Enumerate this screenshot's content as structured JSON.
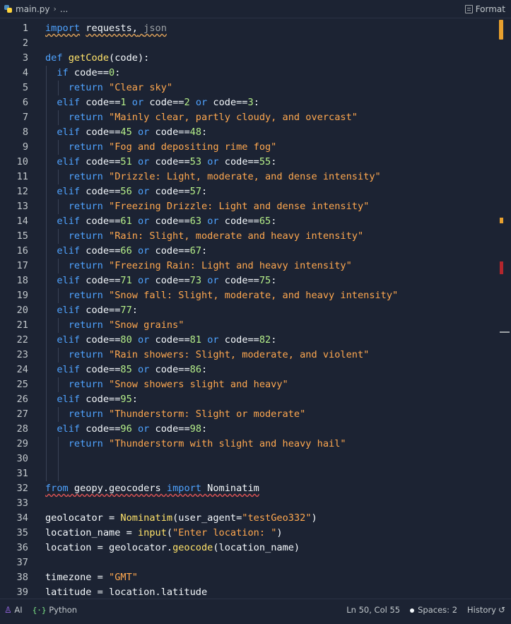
{
  "breadcrumb": {
    "file": "main.py",
    "ellipsis": "..."
  },
  "toolbar": {
    "format_label": "Format"
  },
  "icons": {
    "file": "python-file-icon",
    "format": "format-icon",
    "ai": "ai-icon",
    "language": "braces-icon",
    "history": "history-icon"
  },
  "colors": {
    "background": "#1c2333",
    "keyword": "#4fa3ff",
    "function": "#ffe36a",
    "string": "#ffa84f",
    "number": "#b6f08a",
    "scroll_thumb": "#e8a02e",
    "error_marker": "#b3262d"
  },
  "code_lines": [
    [
      {
        "t": "import",
        "c": "kw sq"
      },
      {
        "t": " ",
        "c": ""
      },
      {
        "t": "requests,",
        "c": "sq"
      },
      {
        "t": " ",
        "c": "sq"
      },
      {
        "t": "json",
        "c": "dim sq"
      }
    ],
    [],
    [
      {
        "t": "def ",
        "c": "kw"
      },
      {
        "t": "getCode",
        "c": "fn"
      },
      {
        "t": "(code):",
        "c": ""
      }
    ],
    [
      {
        "t": "  if ",
        "c": "kw"
      },
      {
        "t": "code==",
        "c": ""
      },
      {
        "t": "0",
        "c": "num"
      },
      {
        "t": ":",
        "c": ""
      }
    ],
    [
      {
        "t": "    return ",
        "c": "kw"
      },
      {
        "t": "\"Clear sky\"",
        "c": "str"
      }
    ],
    [
      {
        "t": "  elif ",
        "c": "kw"
      },
      {
        "t": "code==",
        "c": ""
      },
      {
        "t": "1",
        "c": "num"
      },
      {
        "t": " or ",
        "c": "kw"
      },
      {
        "t": "code==",
        "c": ""
      },
      {
        "t": "2",
        "c": "num"
      },
      {
        "t": " or ",
        "c": "kw"
      },
      {
        "t": "code==",
        "c": ""
      },
      {
        "t": "3",
        "c": "num"
      },
      {
        "t": ":",
        "c": ""
      }
    ],
    [
      {
        "t": "    return ",
        "c": "kw"
      },
      {
        "t": "\"Mainly clear, partly cloudy, and overcast\"",
        "c": "str"
      }
    ],
    [
      {
        "t": "  elif ",
        "c": "kw"
      },
      {
        "t": "code==",
        "c": ""
      },
      {
        "t": "45",
        "c": "num"
      },
      {
        "t": " or ",
        "c": "kw"
      },
      {
        "t": "code==",
        "c": ""
      },
      {
        "t": "48",
        "c": "num"
      },
      {
        "t": ":",
        "c": ""
      }
    ],
    [
      {
        "t": "    return ",
        "c": "kw"
      },
      {
        "t": "\"Fog and depositing rime fog\"",
        "c": "str"
      }
    ],
    [
      {
        "t": "  elif ",
        "c": "kw"
      },
      {
        "t": "code==",
        "c": ""
      },
      {
        "t": "51",
        "c": "num"
      },
      {
        "t": " or ",
        "c": "kw"
      },
      {
        "t": "code==",
        "c": ""
      },
      {
        "t": "53",
        "c": "num"
      },
      {
        "t": " or ",
        "c": "kw"
      },
      {
        "t": "code==",
        "c": ""
      },
      {
        "t": "55",
        "c": "num"
      },
      {
        "t": ":",
        "c": ""
      }
    ],
    [
      {
        "t": "    return ",
        "c": "kw"
      },
      {
        "t": "\"Drizzle: Light, moderate, and dense intensity\"",
        "c": "str"
      }
    ],
    [
      {
        "t": "  elif ",
        "c": "kw"
      },
      {
        "t": "code==",
        "c": ""
      },
      {
        "t": "56",
        "c": "num"
      },
      {
        "t": " or ",
        "c": "kw"
      },
      {
        "t": "code==",
        "c": ""
      },
      {
        "t": "57",
        "c": "num"
      },
      {
        "t": ":",
        "c": ""
      }
    ],
    [
      {
        "t": "    return ",
        "c": "kw"
      },
      {
        "t": "\"Freezing Drizzle: Light and dense intensity\"",
        "c": "str"
      }
    ],
    [
      {
        "t": "  elif ",
        "c": "kw"
      },
      {
        "t": "code==",
        "c": ""
      },
      {
        "t": "61",
        "c": "num"
      },
      {
        "t": " or ",
        "c": "kw"
      },
      {
        "t": "code==",
        "c": ""
      },
      {
        "t": "63",
        "c": "num"
      },
      {
        "t": " or ",
        "c": "kw"
      },
      {
        "t": "code==",
        "c": ""
      },
      {
        "t": "65",
        "c": "num"
      },
      {
        "t": ":",
        "c": ""
      }
    ],
    [
      {
        "t": "    return ",
        "c": "kw"
      },
      {
        "t": "\"Rain: Slight, moderate and heavy intensity\"",
        "c": "str"
      }
    ],
    [
      {
        "t": "  elif ",
        "c": "kw"
      },
      {
        "t": "code==",
        "c": ""
      },
      {
        "t": "66",
        "c": "num"
      },
      {
        "t": " or ",
        "c": "kw"
      },
      {
        "t": "code==",
        "c": ""
      },
      {
        "t": "67",
        "c": "num"
      },
      {
        "t": ":",
        "c": ""
      }
    ],
    [
      {
        "t": "    return ",
        "c": "kw"
      },
      {
        "t": "\"Freezing Rain: Light and heavy intensity\"",
        "c": "str"
      }
    ],
    [
      {
        "t": "  elif ",
        "c": "kw"
      },
      {
        "t": "code==",
        "c": ""
      },
      {
        "t": "71",
        "c": "num"
      },
      {
        "t": " or ",
        "c": "kw"
      },
      {
        "t": "code==",
        "c": ""
      },
      {
        "t": "73",
        "c": "num"
      },
      {
        "t": " or ",
        "c": "kw"
      },
      {
        "t": "code==",
        "c": ""
      },
      {
        "t": "75",
        "c": "num"
      },
      {
        "t": ":",
        "c": ""
      }
    ],
    [
      {
        "t": "    return ",
        "c": "kw"
      },
      {
        "t": "\"Snow fall: Slight, moderate, and heavy intensity\"",
        "c": "str"
      }
    ],
    [
      {
        "t": "  elif ",
        "c": "kw"
      },
      {
        "t": "code==",
        "c": ""
      },
      {
        "t": "77",
        "c": "num"
      },
      {
        "t": ":",
        "c": ""
      }
    ],
    [
      {
        "t": "    return ",
        "c": "kw"
      },
      {
        "t": "\"Snow grains\"",
        "c": "str"
      }
    ],
    [
      {
        "t": "  elif ",
        "c": "kw"
      },
      {
        "t": "code==",
        "c": ""
      },
      {
        "t": "80",
        "c": "num"
      },
      {
        "t": " or ",
        "c": "kw"
      },
      {
        "t": "code==",
        "c": ""
      },
      {
        "t": "81",
        "c": "num"
      },
      {
        "t": " or ",
        "c": "kw"
      },
      {
        "t": "code==",
        "c": ""
      },
      {
        "t": "82",
        "c": "num"
      },
      {
        "t": ":",
        "c": ""
      }
    ],
    [
      {
        "t": "    return ",
        "c": "kw"
      },
      {
        "t": "\"Rain showers: Slight, moderate, and violent\"",
        "c": "str"
      }
    ],
    [
      {
        "t": "  elif ",
        "c": "kw"
      },
      {
        "t": "code==",
        "c": ""
      },
      {
        "t": "85",
        "c": "num"
      },
      {
        "t": " or ",
        "c": "kw"
      },
      {
        "t": "code==",
        "c": ""
      },
      {
        "t": "86",
        "c": "num"
      },
      {
        "t": ":",
        "c": ""
      }
    ],
    [
      {
        "t": "    return ",
        "c": "kw"
      },
      {
        "t": "\"Snow showers slight and heavy\"",
        "c": "str"
      }
    ],
    [
      {
        "t": "  elif ",
        "c": "kw"
      },
      {
        "t": "code==",
        "c": ""
      },
      {
        "t": "95",
        "c": "num"
      },
      {
        "t": ":",
        "c": ""
      }
    ],
    [
      {
        "t": "    return ",
        "c": "kw"
      },
      {
        "t": "\"Thunderstorm: Slight or moderate\"",
        "c": "str"
      }
    ],
    [
      {
        "t": "  elif ",
        "c": "kw"
      },
      {
        "t": "code==",
        "c": ""
      },
      {
        "t": "96",
        "c": "num"
      },
      {
        "t": " or ",
        "c": "kw"
      },
      {
        "t": "code==",
        "c": ""
      },
      {
        "t": "98",
        "c": "num"
      },
      {
        "t": ":",
        "c": ""
      }
    ],
    [
      {
        "t": "    return ",
        "c": "kw"
      },
      {
        "t": "\"Thunderstorm with slight and heavy hail\"",
        "c": "str"
      }
    ],
    [],
    [],
    [
      {
        "t": "from",
        "c": "kw sqr"
      },
      {
        "t": " geopy.geocoders ",
        "c": "sqr"
      },
      {
        "t": "import",
        "c": "kw sqr"
      },
      {
        "t": " Nominatim",
        "c": "sqr"
      }
    ],
    [],
    [
      {
        "t": "geolocator = ",
        "c": ""
      },
      {
        "t": "Nominatim",
        "c": "fn"
      },
      {
        "t": "(user_agent=",
        "c": ""
      },
      {
        "t": "\"testGeo332\"",
        "c": "str"
      },
      {
        "t": ")",
        "c": ""
      }
    ],
    [
      {
        "t": "location_name = ",
        "c": ""
      },
      {
        "t": "input",
        "c": "fn"
      },
      {
        "t": "(",
        "c": ""
      },
      {
        "t": "\"Enter location: \"",
        "c": "str"
      },
      {
        "t": ")",
        "c": ""
      }
    ],
    [
      {
        "t": "location = geolocator.",
        "c": ""
      },
      {
        "t": "geocode",
        "c": "fn"
      },
      {
        "t": "(location_name)",
        "c": ""
      }
    ],
    [],
    [
      {
        "t": "timezone = ",
        "c": ""
      },
      {
        "t": "\"GMT\"",
        "c": "str"
      }
    ],
    [
      {
        "t": "latitude = location.",
        "c": ""
      },
      {
        "t": "latitude",
        "c": "sqr"
      }
    ]
  ],
  "status": {
    "ai_label": "AI",
    "language_label": "Python",
    "cursor": "Ln 50, Col 55",
    "spaces": "Spaces: 2",
    "history_label": "History"
  }
}
